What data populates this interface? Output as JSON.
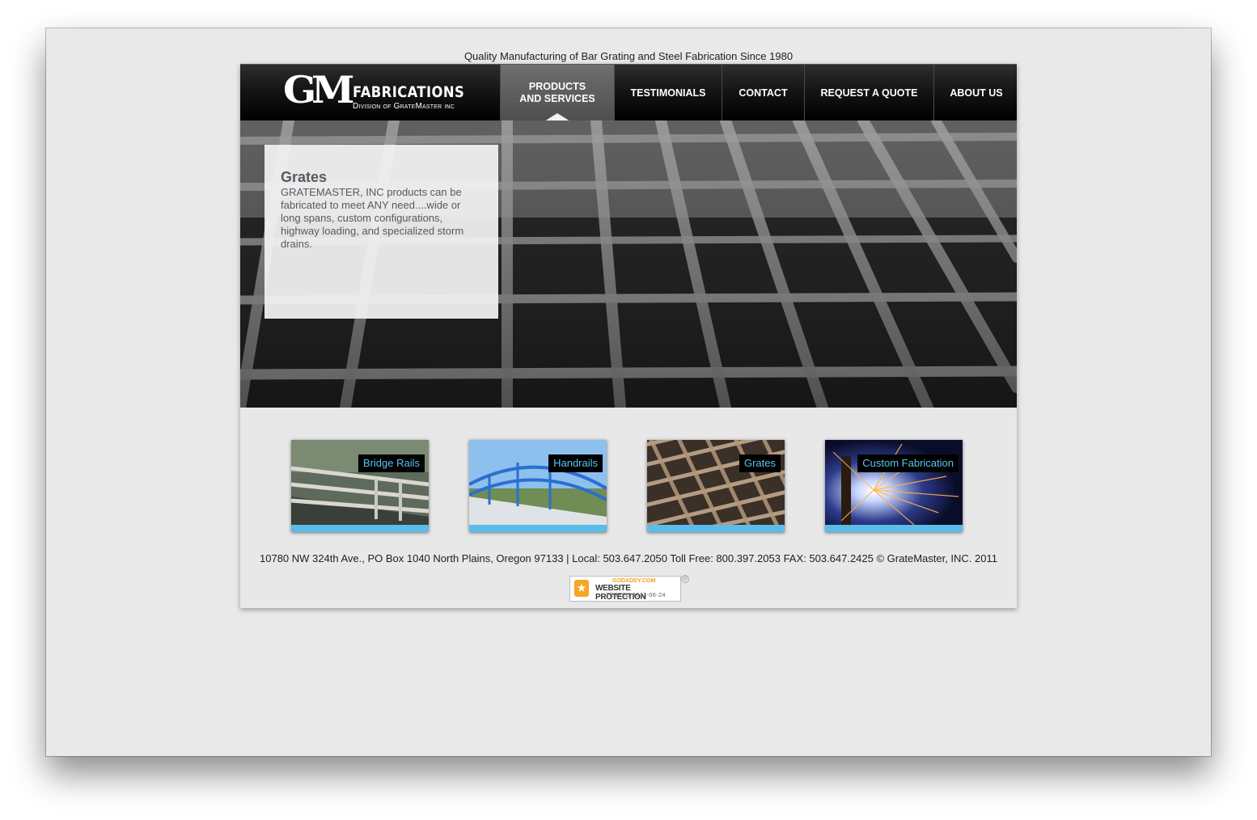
{
  "tagline": "Quality Manufacturing of Bar Grating and Steel Fabrication Since 1980",
  "logo": {
    "mark": "GM",
    "name": "FABRICATIONS",
    "division": "Division of GrateMaster inc"
  },
  "nav": {
    "items": [
      {
        "label": "PRODUCTS\nAND SERVICES",
        "active": true
      },
      {
        "label": "TESTIMONIALS"
      },
      {
        "label": "CONTACT"
      },
      {
        "label": "REQUEST A QUOTE"
      },
      {
        "label": "ABOUT US"
      }
    ]
  },
  "hero": {
    "title": "Grates",
    "text": "GRATEMASTER, INC products can be fabricated to meet ANY need....wide or long spans, custom configurations, highway loading, and specialized storm drains."
  },
  "thumbnails": [
    {
      "label": "Bridge Rails"
    },
    {
      "label": "Handrails"
    },
    {
      "label": "Grates"
    },
    {
      "label": "Custom Fabrication"
    }
  ],
  "footer": {
    "address": "10780 NW 324th Ave., PO Box 1040 North Plains, Oregon 97133 | Local: 503.647.2050 Toll Free: 800.397.2053 FAX: 503.647.2425 © GrateMaster, INC. 2011"
  },
  "badge": {
    "brand": "GODADDY.COM",
    "title": "WEBSITE PROTECTION",
    "tested": "TESTED 2012-06-24",
    "reg": "®"
  },
  "colors": {
    "accent": "#5bbde7",
    "header": "#000000",
    "page": "#e9e9e9"
  }
}
